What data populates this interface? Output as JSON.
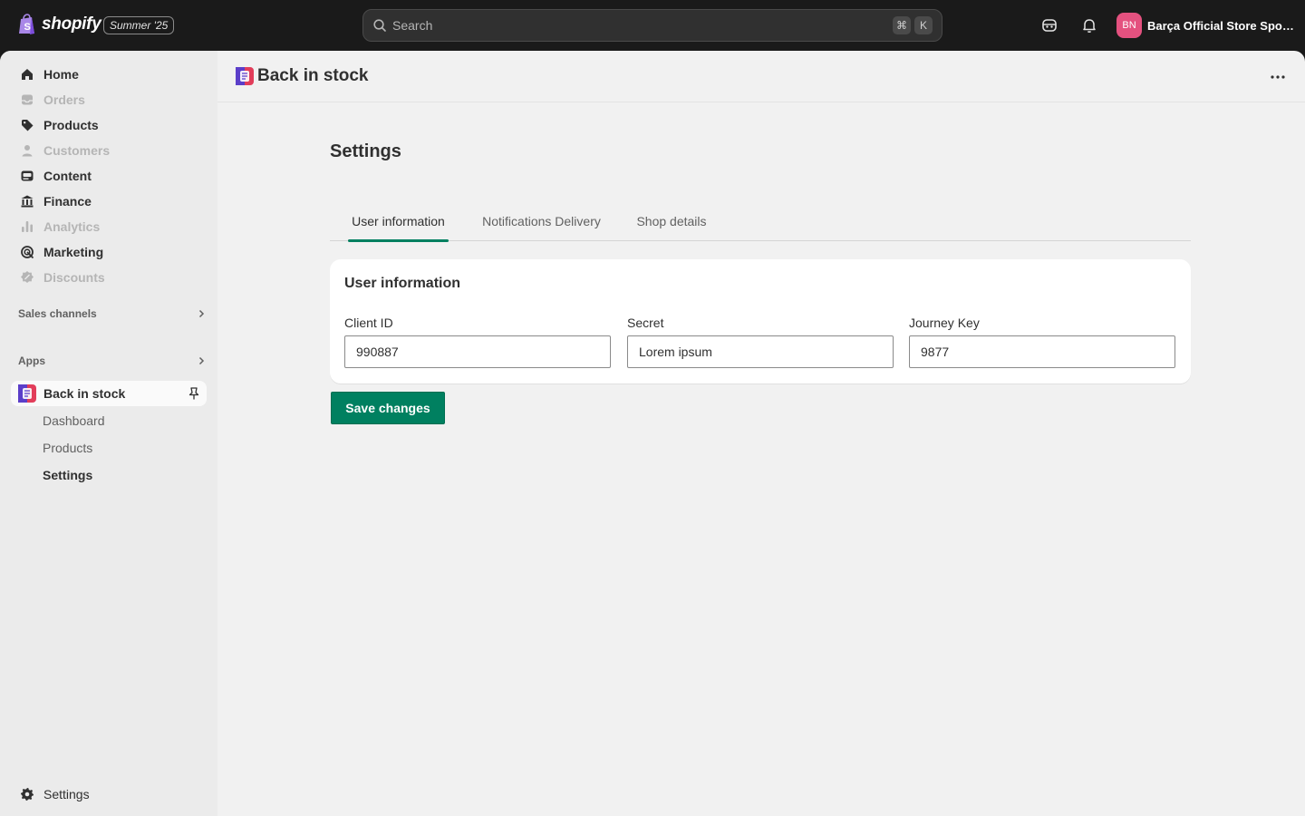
{
  "topbar": {
    "brand": "shopify",
    "edition": "Summer '25",
    "search_placeholder": "Search",
    "shortcut_keys": [
      "⌘",
      "K"
    ],
    "avatar_initials": "BN",
    "store_name": "Barça Official Store Spotif..."
  },
  "sidebar": {
    "items": [
      {
        "label": "Home",
        "icon": "home-icon",
        "disabled": false
      },
      {
        "label": "Orders",
        "icon": "inbox-icon",
        "disabled": true
      },
      {
        "label": "Products",
        "icon": "tag-icon",
        "disabled": false
      },
      {
        "label": "Customers",
        "icon": "person-icon",
        "disabled": true
      },
      {
        "label": "Content",
        "icon": "content-icon",
        "disabled": false
      },
      {
        "label": "Finance",
        "icon": "bank-icon",
        "disabled": false
      },
      {
        "label": "Analytics",
        "icon": "bar-chart-icon",
        "disabled": true
      },
      {
        "label": "Marketing",
        "icon": "target-icon",
        "disabled": false
      },
      {
        "label": "Discounts",
        "icon": "discount-icon",
        "disabled": true
      }
    ],
    "sales_channels": "Sales channels",
    "apps": "Apps",
    "app": {
      "name": "Back in stock",
      "sub_items": [
        "Dashboard",
        "Products",
        "Settings"
      ],
      "active_sub_item": "Settings"
    },
    "footer_settings": "Settings"
  },
  "main": {
    "app_title": "Back in stock",
    "page_title": "Settings",
    "tabs": [
      "User information",
      "Notifications Delivery",
      "Shop details"
    ],
    "active_tab": "User information",
    "card": {
      "title": "User information",
      "fields": [
        {
          "label": "Client ID",
          "value": "990887"
        },
        {
          "label": "Secret",
          "value": "Lorem ipsum"
        },
        {
          "label": "Journey Key",
          "value": "9877"
        }
      ]
    },
    "save_label": "Save changes"
  },
  "colors": {
    "topbar_bg": "#1a1a1a",
    "primary_button": "#008060",
    "avatar": "#e4517f",
    "active_tab_underline": "#008060"
  }
}
